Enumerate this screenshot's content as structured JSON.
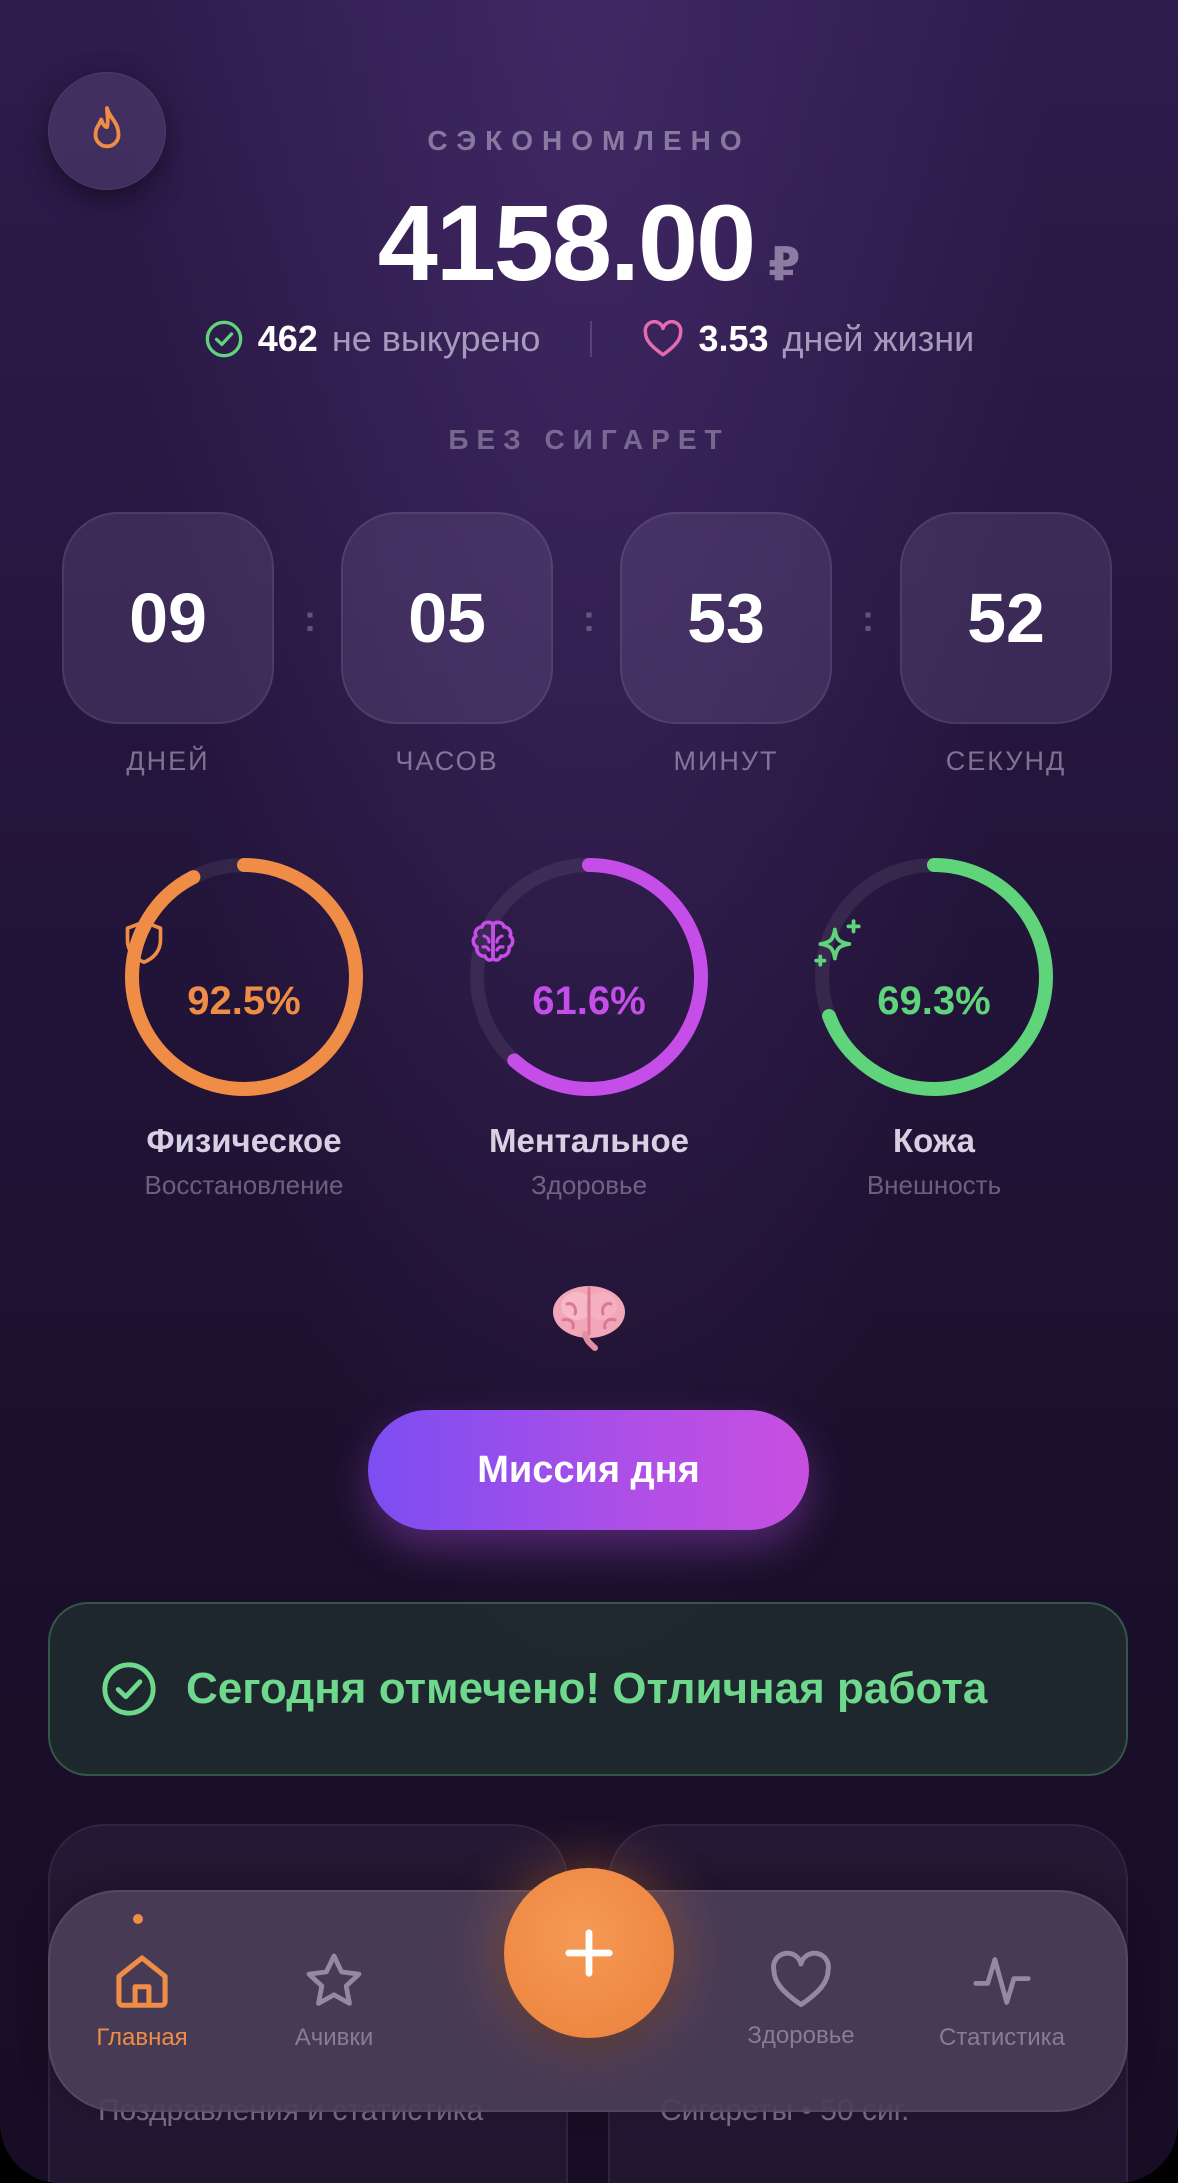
{
  "header": {
    "saved_label": "СЭКОНОМЛЕНО",
    "saved_value": "4158.00",
    "currency": "₽",
    "not_smoked_count": "462",
    "not_smoked_label": "не выкурено",
    "life_days_count": "3.53",
    "life_days_label": "дней жизни"
  },
  "timer": {
    "label": "БЕЗ СИГАРЕТ",
    "separator": ":",
    "units": [
      {
        "value": "09",
        "label": "ДНЕЙ"
      },
      {
        "value": "05",
        "label": "ЧАСОВ"
      },
      {
        "value": "53",
        "label": "МИНУТ"
      },
      {
        "value": "52",
        "label": "СЕКУНД"
      }
    ]
  },
  "rings": [
    {
      "percent_text": "92.5%",
      "fraction": 0.925,
      "title": "Физическое",
      "subtitle": "Восстановление",
      "color": "#ef8c45",
      "icon": "shield-icon"
    },
    {
      "percent_text": "61.6%",
      "fraction": 0.616,
      "title": "Ментальное",
      "subtitle": "Здоровье",
      "color": "#c54de8",
      "icon": "brain-icon"
    },
    {
      "percent_text": "69.3%",
      "fraction": 0.693,
      "title": "Кожа",
      "subtitle": "Внешность",
      "color": "#5fd47a",
      "icon": "sparkle-icon"
    }
  ],
  "mission": {
    "emoji": "brain-emoji",
    "button_label": "Миссия дня"
  },
  "done_banner": {
    "text": "Сегодня отмечено! Отличная работа",
    "color": "#6ed98c"
  },
  "cards_below": {
    "left_text": "Поздравления и статистика",
    "right_text": "Сигареты • 50 сиг."
  },
  "tabbar": {
    "home": "Главная",
    "achievements": "Ачивки",
    "health": "Здоровье",
    "stats": "Статистика",
    "active_color": "#ef8c45",
    "fab_color": "#ef8a45"
  }
}
